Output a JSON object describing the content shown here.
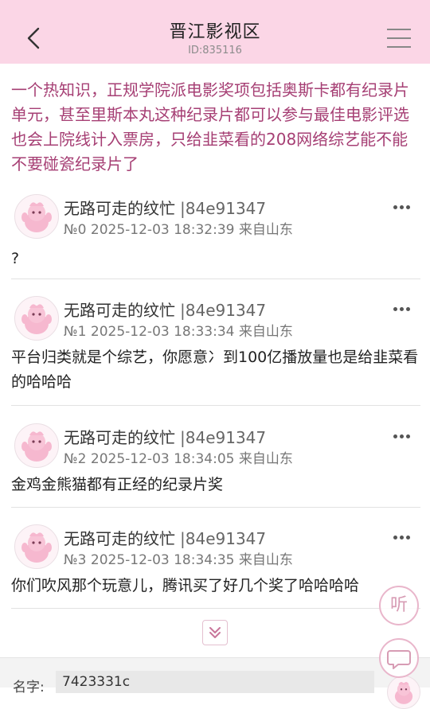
{
  "header": {
    "title": "晋江影视区",
    "id_text": "ID:835116"
  },
  "topic": {
    "text": "一个热知识，正规学院派电影奖项包括奥斯卡都有纪录片单元，甚至里斯本丸这种纪录片都可以参与最佳电影评选也会上院线计入票房，只给韭菜看的208网络综艺能不能不要碰瓷纪录片了"
  },
  "posts": [
    {
      "author": "无路可走的纹忙",
      "uid": "|84e91347",
      "meta": "№0 2025-12-03 18:32:39 来自山东",
      "content": "?"
    },
    {
      "author": "无路可走的纹忙",
      "uid": "|84e91347",
      "meta": "№1 2025-12-03 18:33:34 来自山东",
      "content": "平台归类就是个综艺，你愿意冫到100亿播放量也是给韭菜看的哈哈哈"
    },
    {
      "author": "无路可走的纹忙",
      "uid": "|84e91347",
      "meta": "№2 2025-12-03 18:34:05 来自山东",
      "content": "金鸡金熊猫都有正经的纪录片奖"
    },
    {
      "author": "无路可走的纹忙",
      "uid": "|84e91347",
      "meta": "№3 2025-12-03 18:34:35 来自山东",
      "content": "你们吹风那个玩意儿，腾讯买了好几个奖了哈哈哈哈"
    }
  ],
  "floating": {
    "listen_label": "听"
  },
  "bottom": {
    "name_label": "名字:",
    "name_value": "7423331c"
  },
  "colors": {
    "header_bg": "#fbd6e6",
    "topic_text": "#a63f74",
    "accent_pink": "#e9b6cb"
  }
}
